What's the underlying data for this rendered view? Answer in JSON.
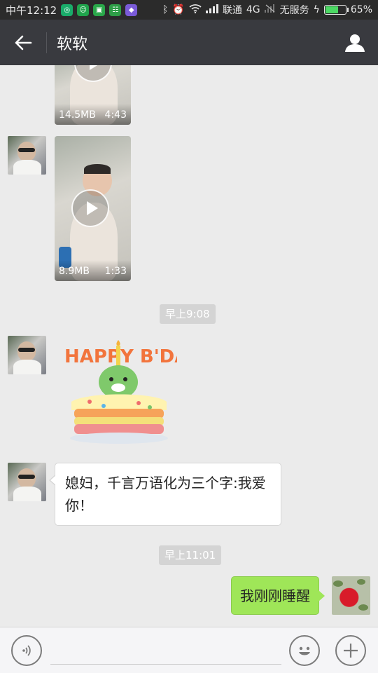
{
  "status_bar": {
    "time": "中午12:12",
    "carrier": "联通",
    "network": "4G",
    "service": "无服务",
    "battery": "65%",
    "battery_level": 0.65
  },
  "header": {
    "title": "软软"
  },
  "messages": {
    "video1": {
      "size": "14.5MB",
      "duration": "4:43"
    },
    "video2": {
      "size": "8.9MB",
      "duration": "1:33"
    },
    "time1": "早上9:08",
    "sticker_text": "HAPPY B'DAY",
    "text1": "媳妇，千言万语化为三个字:我爱你！",
    "time2": "早上11:01",
    "text2": "我刚刚睡醒"
  },
  "colors": {
    "header_bg": "#393a3f",
    "status_bg": "#2b2b2b",
    "chat_bg": "#ebebeb",
    "my_bubble": "#9fe658"
  }
}
